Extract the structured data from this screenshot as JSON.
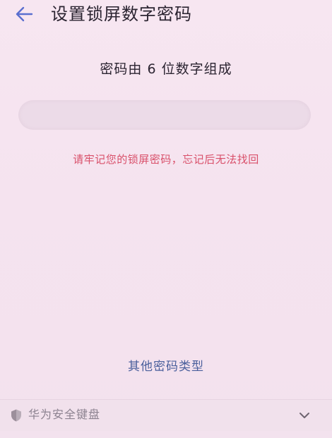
{
  "header": {
    "back_icon": "arrow-left-icon",
    "title": "设置锁屏数字密码"
  },
  "main": {
    "subtitle": "密码由 6 位数字组成",
    "pin_input": {
      "value": "",
      "placeholder": ""
    },
    "warning": "请牢记您的锁屏密码，忘记后无法找回",
    "other_types_link": "其他密码类型"
  },
  "keyboard_bar": {
    "shield_icon": "shield-icon",
    "label": "华为安全键盘",
    "collapse_icon": "chevron-down-icon"
  },
  "colors": {
    "background": "#f6e5f0",
    "accent": "#5a6fcf",
    "warning": "#d9506a",
    "link": "#4a5f9c"
  }
}
